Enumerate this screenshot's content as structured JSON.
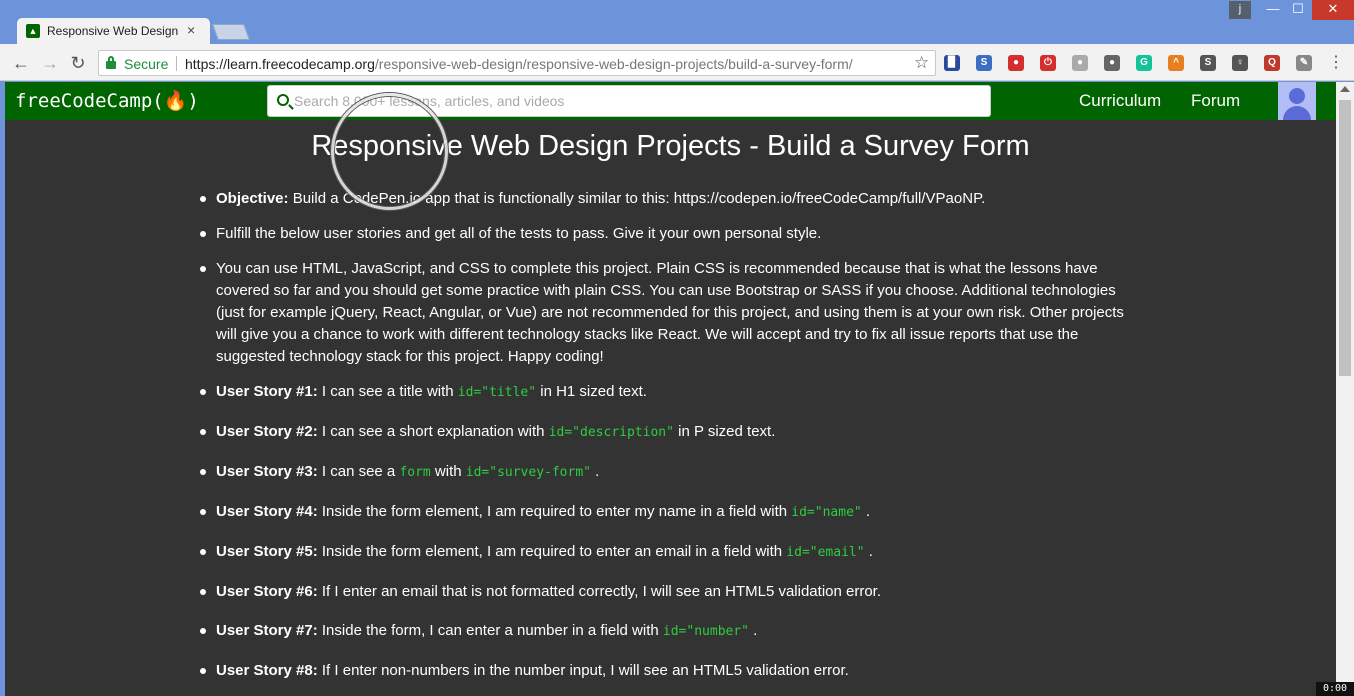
{
  "browser": {
    "tab_title": "Responsive Web Design P",
    "tab_close": "×",
    "profile": "j",
    "window_controls": {
      "minimize": "—",
      "maximize": "☐",
      "close": "✕"
    },
    "secure_label": "Secure",
    "url_scheme_host": "https://learn.freecodecamp.org",
    "url_path": "/responsive-web-design/responsive-web-design-projects/build-a-survey-form/",
    "extensions": [
      {
        "name": "bookmark-ext-icon",
        "color": "#2b4a9c",
        "glyph": "▉"
      },
      {
        "name": "s-ext-icon",
        "color": "#3a6fc4",
        "glyph": "S"
      },
      {
        "name": "shield-ext-icon",
        "color": "#d32f2f",
        "glyph": "●"
      },
      {
        "name": "power-ext-icon",
        "color": "#d32f2f",
        "glyph": "⏻"
      },
      {
        "name": "grey-ext-icon",
        "color": "#aaaaaa",
        "glyph": "●"
      },
      {
        "name": "pin-ext-icon",
        "color": "#666666",
        "glyph": "●"
      },
      {
        "name": "grammarly-icon",
        "color": "#15c39a",
        "glyph": "G"
      },
      {
        "name": "rainbow-ext-icon",
        "color": "#e67e22",
        "glyph": "^"
      },
      {
        "name": "s2-ext-icon",
        "color": "#555555",
        "glyph": "S"
      },
      {
        "name": "bulb-ext-icon",
        "color": "#555555",
        "glyph": "♀"
      },
      {
        "name": "q-ext-icon",
        "color": "#c0392b",
        "glyph": "Q"
      },
      {
        "name": "pen-ext-icon",
        "color": "#888888",
        "glyph": "✎"
      }
    ]
  },
  "navbar": {
    "logo": "freeCodeCamp(🔥)",
    "search_placeholder": "Search 8,000+ lessons, articles, and videos",
    "links": [
      "Curriculum",
      "Forum"
    ]
  },
  "content": {
    "title": "Responsive Web Design Projects - Build a Survey Form",
    "items": [
      {
        "lead": "Objective:",
        "text": " Build a CodePen.io app that is functionally similar to this: https://codepen.io/freeCodeCamp/full/VPaoNP."
      },
      {
        "lead": "",
        "text": "Fulfill the below user stories and get all of the tests to pass. Give it your own personal style."
      },
      {
        "lead": "",
        "text": "You can use HTML, JavaScript, and CSS to complete this project. Plain CSS is recommended because that is what the lessons have covered so far and you should get some practice with plain CSS. You can use Bootstrap or SASS if you choose. Additional technologies (just for example jQuery, React, Angular, or Vue) are not recommended for this project, and using them is at your own risk. Other projects will give you a chance to work with different technology stacks like React. We will accept and try to fix all issue reports that use the suggested technology stack for this project. Happy coding!"
      }
    ],
    "stories": [
      {
        "lead": "User Story #1:",
        "parts": [
          {
            "t": " I can see a title with "
          },
          {
            "c": "id=\"title\""
          },
          {
            "t": " in H1 sized text."
          }
        ]
      },
      {
        "lead": "User Story #2:",
        "parts": [
          {
            "t": " I can see a short explanation with "
          },
          {
            "c": "id=\"description\""
          },
          {
            "t": " in P sized text."
          }
        ]
      },
      {
        "lead": "User Story #3:",
        "parts": [
          {
            "t": " I can see a "
          },
          {
            "c": "form"
          },
          {
            "t": " with "
          },
          {
            "c": "id=\"survey-form\""
          },
          {
            "t": " ."
          }
        ]
      },
      {
        "lead": "User Story #4:",
        "parts": [
          {
            "t": " Inside the form element, I am required to enter my name in a field with "
          },
          {
            "c": "id=\"name\""
          },
          {
            "t": " ."
          }
        ]
      },
      {
        "lead": "User Story #5:",
        "parts": [
          {
            "t": " Inside the form element, I am required to enter an email in a field with "
          },
          {
            "c": "id=\"email\""
          },
          {
            "t": " ."
          }
        ]
      },
      {
        "lead": "User Story #6:",
        "parts": [
          {
            "t": " If I enter an email that is not formatted correctly, I will see an HTML5 validation error."
          }
        ]
      },
      {
        "lead": "User Story #7:",
        "parts": [
          {
            "t": " Inside the form, I can enter a number in a field with "
          },
          {
            "c": "id=\"number\""
          },
          {
            "t": " ."
          }
        ]
      },
      {
        "lead": "User Story #8:",
        "parts": [
          {
            "t": " If I enter non-numbers in the number input, I will see an HTML5 validation error."
          }
        ]
      }
    ]
  },
  "overlay": {
    "timer": "0:00"
  }
}
